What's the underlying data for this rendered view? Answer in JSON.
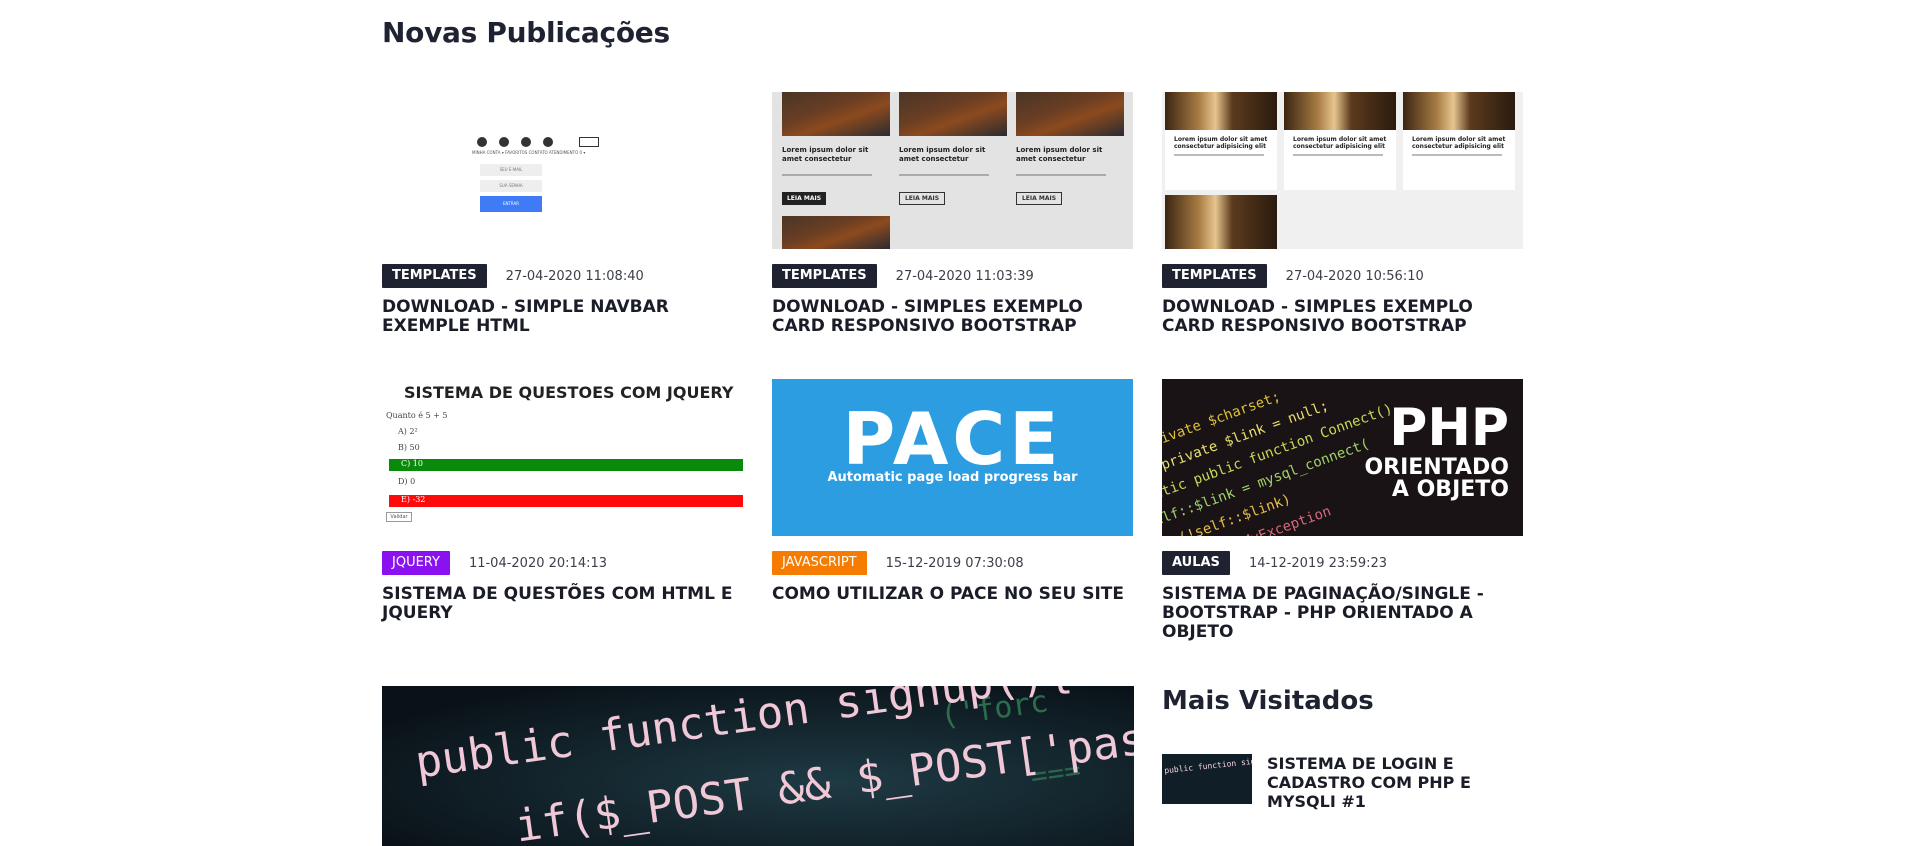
{
  "section": {
    "title": "Novas Publicações"
  },
  "posts": [
    {
      "category": "TEMPLATES",
      "category_color": "#1f2230",
      "date": "27-04-2020 11:08:40",
      "title": "DOWNLOAD - SIMPLE NAVBAR EXEMPLE HTML"
    },
    {
      "category": "TEMPLATES",
      "category_color": "#1f2230",
      "date": "27-04-2020 11:03:39",
      "title": "DOWNLOAD - SIMPLES EXEMPLO CARD RESPONSIVO BOOTSTRAP"
    },
    {
      "category": "TEMPLATES",
      "category_color": "#1f2230",
      "date": "27-04-2020 10:56:10",
      "title": "DOWNLOAD - SIMPLES EXEMPLO CARD RESPONSIVO BOOTSTRAP"
    },
    {
      "category": "JQUERY",
      "category_color": "#8a12f0",
      "date": "11-04-2020 20:14:13",
      "title": "SISTEMA DE QUESTÕES COM HTML E JQUERY"
    },
    {
      "category": "JAVASCRIPT",
      "category_color": "#f57c00",
      "date": "15-12-2019 07:30:08",
      "title": "COMO UTILIZAR O PACE NO SEU SITE"
    },
    {
      "category": "AULAS",
      "category_color": "#1f2230",
      "date": "14-12-2019 23:59:23",
      "title": "SISTEMA DE PAGINAÇÃO/SINGLE - BOOTSTRAP - PHP ORIENTADO A OBJETO"
    }
  ],
  "thumbs": {
    "t1": {
      "icon_labels": [
        "MINHA CONTA ▾",
        "FAVORITOS",
        "CONTATO",
        "ATENDIMENTO",
        "0 ▾"
      ],
      "field1": "SEU E-MAIL",
      "field2": "SUA SENHA",
      "button": "ENTRAR"
    },
    "t2": {
      "card_title": "Lorem ipsum dolor sit amet consectetur",
      "button": "LEIA MAIS"
    },
    "t3": {
      "card_title": "Lorem ipsum dolor sit amet consectetur adipisicing elit"
    },
    "t4": {
      "heading": "SISTEMA DE QUESTOES COM JQUERY",
      "question": "Quanto é 5 + 5",
      "options": [
        "A) 2²",
        "B) 50",
        "C) 10",
        "D) 0",
        "E) -32"
      ],
      "button": "Validar"
    },
    "t5": {
      "big": "PACE",
      "sub": "Automatic page load progress bar"
    },
    "t6": {
      "line1": "PHP",
      "line2": "ORIENTADO",
      "line3": "A OBJETO"
    }
  },
  "featured": {
    "code_line1": "public function signup(){",
    "code_line2": "if($_POST && $_POST['passw"
  },
  "sidebar": {
    "title": "Mais Visitados",
    "items": [
      {
        "title": "SISTEMA DE LOGIN E CADASTRO COM PHP E MYSQLI #1"
      }
    ]
  }
}
